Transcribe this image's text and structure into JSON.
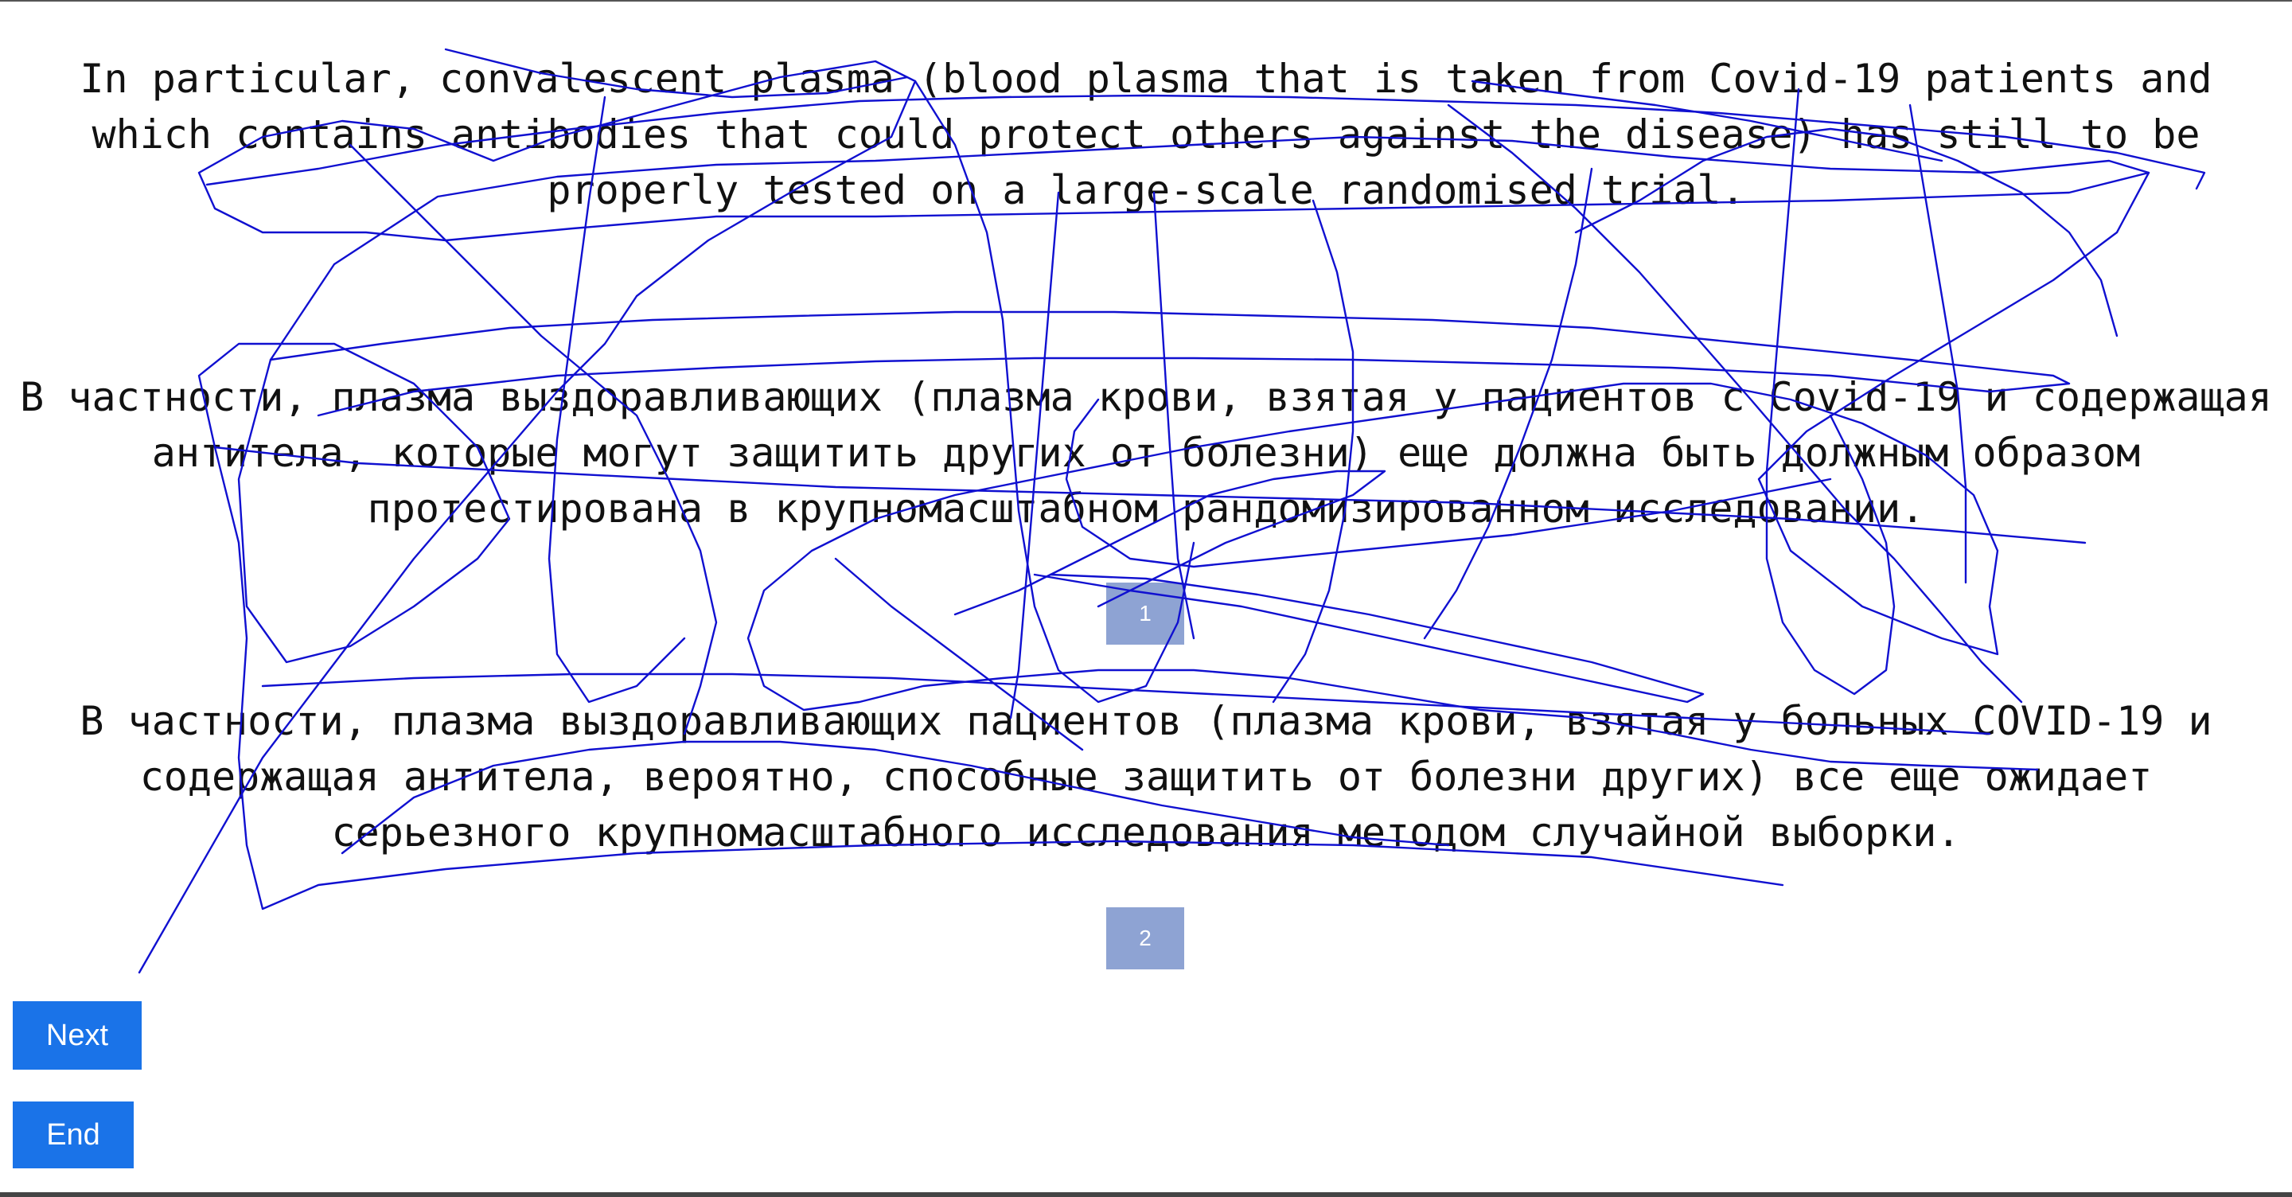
{
  "texts": {
    "source": "In particular, convalescent plasma (blood plasma that is taken from Covid-19 patients and which contains antibodies that could protect others against the disease) has still to be properly tested on a large-scale randomised trial.",
    "translation_1": "В частности, плазма выздоравливающих (плазма крови, взятая у пациентов с Covid-19 и содержащая антитела, которые могут защитить других от болезни) еще должна быть должным образом протестирована в крупномасштабном рандомизированном исследовании.",
    "translation_2": "В частности, плазма выздоравливающих пациентов (плазма крови, взятая у больных COVID-19 и содержащая антитела, вероятно, способные защитить от болезни других) все еще ожидает серьезного крупномасштабного исследования методом случайной выборки."
  },
  "rank_buttons": {
    "first": "1",
    "second": "2"
  },
  "nav": {
    "next_label": "Next",
    "end_label": "End"
  },
  "colors": {
    "rank_button": "#8ea3d3",
    "nav_button": "#1a73e8",
    "scribble": "#1010d0"
  }
}
